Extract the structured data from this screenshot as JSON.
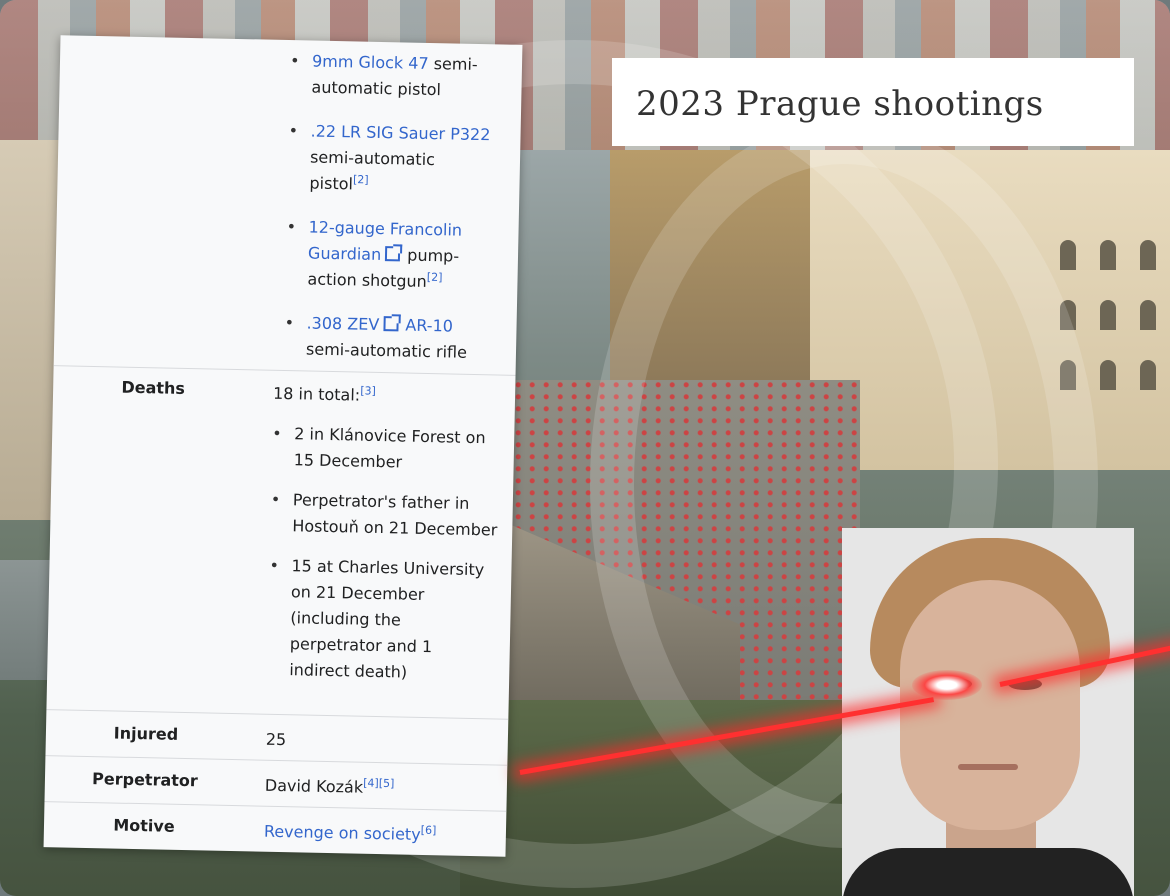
{
  "title": "2023 Prague shootings",
  "weapons": [
    {
      "link": "9mm Glock 47",
      "text": " semi-automatic pistol",
      "ref": ""
    },
    {
      "link": ".22 LR SIG Sauer P322",
      "text": " semi-automatic pistol",
      "ref": "[2]"
    },
    {
      "link": "12-gauge Francolin Guardian",
      "text": " pump-action shotgun",
      "ref": "[2]",
      "external": true
    },
    {
      "link": ".308 ZEV",
      "link2": "AR-10",
      "text": " semi-automatic rifle",
      "ref": "",
      "external": true
    }
  ],
  "deaths": {
    "label": "Deaths",
    "summary": "18 in total:",
    "summary_ref": "[3]",
    "items": [
      "2 in Klánovice Forest on 15 December",
      "Perpetrator's father in Hostouň on 21 December",
      "15 at Charles University on 21 December (including the perpetrator and 1 indirect death)"
    ]
  },
  "injured": {
    "label": "Injured",
    "value": "25"
  },
  "perpetrator": {
    "label": "Perpetrator",
    "value": "David Kozák",
    "ref": "[4][5]"
  },
  "motive": {
    "label": "Motive",
    "value": "Revenge on society",
    "ref": "[6]"
  }
}
